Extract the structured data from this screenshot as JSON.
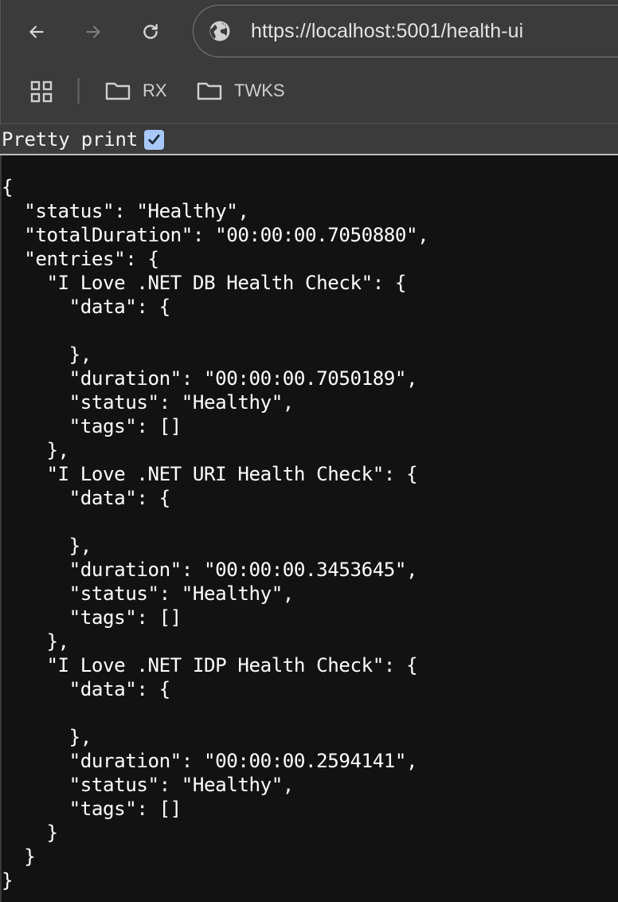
{
  "browser": {
    "url": "https://localhost:5001/health-ui",
    "icons": {
      "back": "arrow-left-icon",
      "forward": "arrow-right-icon",
      "reload": "reload-icon",
      "site_info": "globe-icon",
      "apps": "apps-grid-icon",
      "folder": "folder-icon"
    },
    "bookmarks": [
      {
        "label": "RX"
      },
      {
        "label": "TWKS"
      }
    ]
  },
  "pretty_print": {
    "label": "Pretty print",
    "checked": true,
    "accent_color": "#a8c7fa"
  },
  "json_lines": [
    "{",
    "  \"status\": \"Healthy\",",
    "  \"totalDuration\": \"00:00:00.7050880\",",
    "  \"entries\": {",
    "    \"I Love .NET DB Health Check\": {",
    "      \"data\": {",
    "",
    "      },",
    "      \"duration\": \"00:00:00.7050189\",",
    "      \"status\": \"Healthy\",",
    "      \"tags\": []",
    "    },",
    "    \"I Love .NET URI Health Check\": {",
    "      \"data\": {",
    "",
    "      },",
    "      \"duration\": \"00:00:00.3453645\",",
    "      \"status\": \"Healthy\",",
    "      \"tags\": []",
    "    },",
    "    \"I Love .NET IDP Health Check\": {",
    "      \"data\": {",
    "",
    "      },",
    "      \"duration\": \"00:00:00.2594141\",",
    "      \"status\": \"Healthy\",",
    "      \"tags\": []",
    "    }",
    "  }",
    "}"
  ],
  "health": {
    "status": "Healthy",
    "totalDuration": "00:00:00.7050880",
    "entries": [
      {
        "name": "I Love .NET DB Health Check",
        "duration": "00:00:00.7050189",
        "status": "Healthy",
        "tags": []
      },
      {
        "name": "I Love .NET URI Health Check",
        "duration": "00:00:00.3453645",
        "status": "Healthy",
        "tags": []
      },
      {
        "name": "I Love .NET IDP Health Check",
        "duration": "00:00:00.2594141",
        "status": "Healthy",
        "tags": []
      }
    ]
  }
}
